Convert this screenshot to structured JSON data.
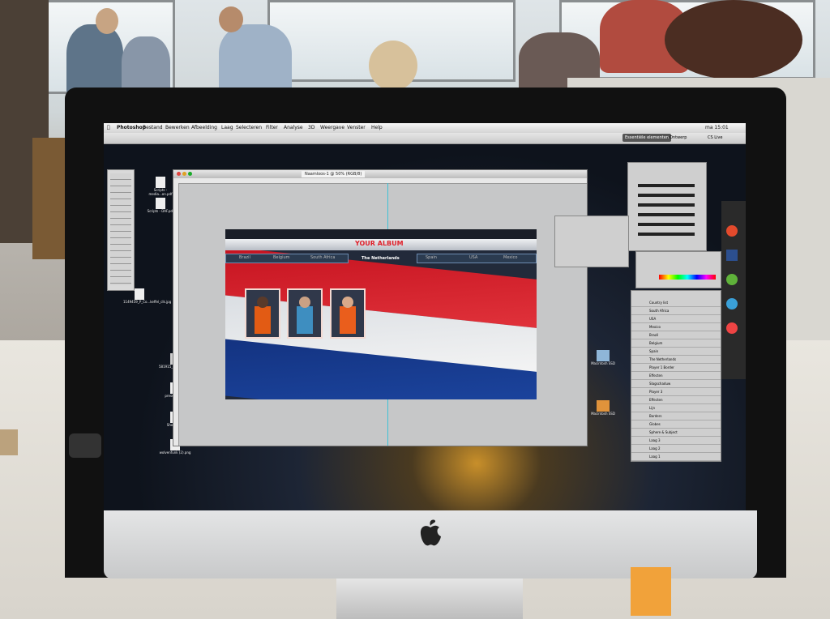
{
  "menubar": {
    "app": "Photoshop",
    "items": [
      "Bestand",
      "Bewerken",
      "Afbeelding",
      "Laag",
      "Selecteren",
      "Filter",
      "Analyse",
      "3D",
      "Weergave",
      "Venster",
      "Help"
    ],
    "clock": "ma 15:01"
  },
  "optionsbar": {
    "workspace": "Essentiële elementen",
    "ontwerp": "Ontwerp",
    "cslive": "CS Live"
  },
  "document": {
    "tab_title": "Naamloos-1 @ 50% (RGB/8)"
  },
  "album": {
    "title": "YOUR ALBUM",
    "nav_left": [
      "Brazil",
      "Belgium",
      "South Africa"
    ],
    "nav_center": "The Netherlands",
    "nav_right": [
      "Spain",
      "USA",
      "Mexico"
    ]
  },
  "layers": {
    "items": [
      "Country list",
      "South Africa",
      "USA",
      "Mexico",
      "Brazil",
      "Belgium",
      "Spain",
      "The Netherlands",
      "Player 1 Border",
      "Effecten",
      "Slagschaduw",
      "Player 3",
      "Effecten",
      "Lijn",
      "Borders",
      "Globes",
      "Sphere & Subject",
      "Laag 3",
      "Laag 2",
      "Laag 1"
    ]
  },
  "desktop": {
    "icons": [
      "Scripts - media...on.pdf",
      "Scripts - DAF.pdf",
      "1149459_P_Co...keffel_clk.jpg",
      "581915_1017...82341__n.jpg",
      "present3.jpg",
      "Shoot.png",
      "wolvenfunk (2).png",
      "Macintosh SSD",
      "Macintosh SSD"
    ]
  }
}
